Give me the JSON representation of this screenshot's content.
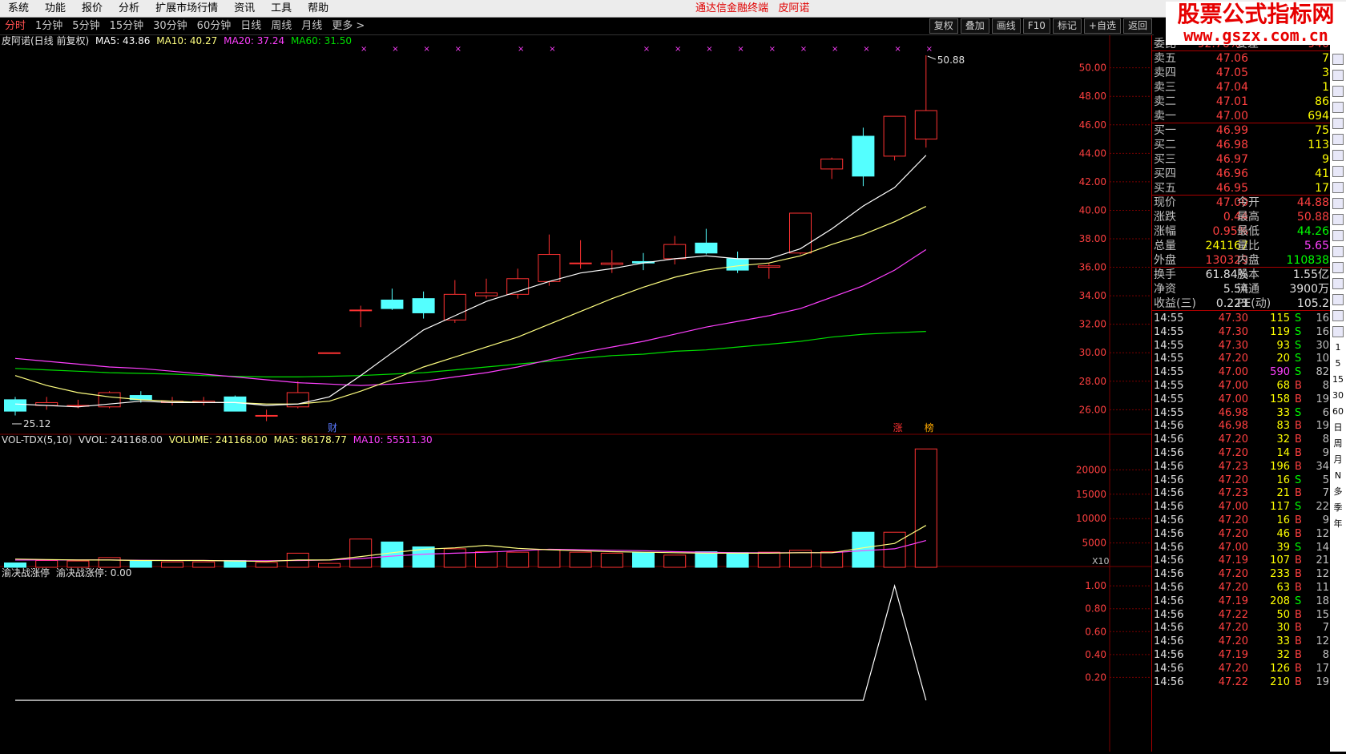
{
  "menu": [
    "系统",
    "功能",
    "报价",
    "分析",
    "扩展市场行情",
    "资讯",
    "工具",
    "帮助"
  ],
  "window_title": "通达信金融终端",
  "stock_name": "皮阿诺",
  "periods": [
    "分时",
    "1分钟",
    "5分钟",
    "15分钟",
    "30分钟",
    "60分钟",
    "日线",
    "周线",
    "月线",
    "更多 >"
  ],
  "active_period": "分时",
  "toolbar_buttons": [
    "复权",
    "叠加",
    "画线",
    "F10",
    "标记",
    "+自选",
    "返回"
  ],
  "logo": {
    "line1": "股票公式指标网",
    "line2": "www.gszx.com.cn"
  },
  "main_header": {
    "name": "皮阿诺(日线 前复权)",
    "ma5": "MA5: 43.86",
    "ma10": "MA10: 40.27",
    "ma20": "MA20: 37.24",
    "ma60": "MA60: 31.50"
  },
  "vol_header": {
    "name": "VOL-TDX(5,10)",
    "vvol": "VVOL: 241168.00",
    "volume": "VOLUME: 241168.00",
    "ma5": "MA5: 86178.77",
    "ma10": "MA10: 55511.30"
  },
  "ind_header": {
    "name": "渝决战涨停",
    "val": "渝决战涨停: 0.00"
  },
  "x10": "X10",
  "price_labels": [
    "50.00",
    "48.00",
    "46.00",
    "44.00",
    "42.00",
    "40.00",
    "38.00",
    "36.00",
    "34.00",
    "32.00",
    "30.00",
    "28.00",
    "26.00"
  ],
  "vol_labels": [
    "20000",
    "15000",
    "10000",
    "5000"
  ],
  "ind_labels": [
    "1.00",
    "0.80",
    "0.60",
    "0.40",
    "0.20"
  ],
  "high_mark": "50.88",
  "low_mark": "25.12",
  "events": [
    "财",
    "涨",
    "榜"
  ],
  "colors": {
    "up": "#ff3232",
    "down": "#54ffff",
    "ma5": "#ffffff",
    "ma10": "#ffff80",
    "ma20": "#ff40ff",
    "ma60": "#00e000",
    "grid": "#7a0000"
  },
  "chart_data": {
    "type": "candlestick",
    "ylim": [
      24.5,
      51.5
    ],
    "candles": [
      {
        "o": 26.7,
        "c": 25.9,
        "h": 26.9,
        "l": 25.6
      },
      {
        "o": 26.3,
        "c": 26.5,
        "h": 26.9,
        "l": 26.0
      },
      {
        "o": 26.3,
        "c": 26.3,
        "h": 26.7,
        "l": 26.1
      },
      {
        "o": 26.2,
        "c": 27.2,
        "h": 27.3,
        "l": 26.1
      },
      {
        "o": 27.0,
        "c": 26.7,
        "h": 27.3,
        "l": 26.5
      },
      {
        "o": 26.5,
        "c": 26.6,
        "h": 26.9,
        "l": 26.3
      },
      {
        "o": 26.5,
        "c": 26.6,
        "h": 26.9,
        "l": 26.3
      },
      {
        "o": 26.9,
        "c": 25.9,
        "h": 27.0,
        "l": 25.9
      },
      {
        "o": 25.6,
        "c": 25.6,
        "h": 26.0,
        "l": 25.2
      },
      {
        "o": 26.2,
        "c": 27.2,
        "h": 28.0,
        "l": 26.1
      },
      {
        "o": 30.0,
        "c": 30.0,
        "h": 30.0,
        "l": 30.0
      },
      {
        "o": 33.0,
        "c": 33.0,
        "h": 33.3,
        "l": 31.8
      },
      {
        "o": 33.7,
        "c": 33.1,
        "h": 34.5,
        "l": 33.0
      },
      {
        "o": 33.8,
        "c": 32.8,
        "h": 34.3,
        "l": 32.4
      },
      {
        "o": 32.3,
        "c": 34.1,
        "h": 35.1,
        "l": 32.1
      },
      {
        "o": 34.0,
        "c": 34.2,
        "h": 35.2,
        "l": 33.8
      },
      {
        "o": 34.1,
        "c": 35.2,
        "h": 35.9,
        "l": 33.8
      },
      {
        "o": 35.0,
        "c": 36.9,
        "h": 38.3,
        "l": 34.7
      },
      {
        "o": 36.3,
        "c": 36.3,
        "h": 37.9,
        "l": 35.9
      },
      {
        "o": 36.2,
        "c": 36.3,
        "h": 37.2,
        "l": 35.6
      },
      {
        "o": 36.4,
        "c": 36.3,
        "h": 37.0,
        "l": 35.8
      },
      {
        "o": 36.6,
        "c": 37.6,
        "h": 38.2,
        "l": 36.2
      },
      {
        "o": 37.7,
        "c": 37.0,
        "h": 38.7,
        "l": 36.9
      },
      {
        "o": 36.6,
        "c": 35.8,
        "h": 37.1,
        "l": 35.6
      },
      {
        "o": 36.0,
        "c": 36.1,
        "h": 36.3,
        "l": 35.2
      },
      {
        "o": 37.0,
        "c": 39.8,
        "h": 39.8,
        "l": 36.9
      },
      {
        "o": 42.9,
        "c": 43.6,
        "h": 43.7,
        "l": 42.2
      },
      {
        "o": 45.2,
        "c": 42.4,
        "h": 45.8,
        "l": 41.7
      },
      {
        "o": 43.8,
        "c": 46.6,
        "h": 46.6,
        "l": 43.5
      },
      {
        "o": 45.0,
        "c": 47.0,
        "h": 50.88,
        "l": 44.4
      }
    ],
    "ma5": [
      26.4,
      26.3,
      26.2,
      26.4,
      26.6,
      26.5,
      26.5,
      26.5,
      26.3,
      26.4,
      26.9,
      28.4,
      30.0,
      31.6,
      32.6,
      33.6,
      34.3,
      35.0,
      35.6,
      35.9,
      36.3,
      36.6,
      36.8,
      36.6,
      36.6,
      37.3,
      38.7,
      40.3,
      41.6,
      43.86
    ],
    "ma10": [
      28.4,
      27.7,
      27.2,
      26.9,
      26.7,
      26.6,
      26.5,
      26.5,
      26.4,
      26.4,
      26.6,
      27.3,
      28.1,
      29.0,
      29.7,
      30.4,
      31.1,
      32.0,
      32.9,
      33.8,
      34.6,
      35.3,
      35.8,
      36.1,
      36.3,
      36.8,
      37.6,
      38.3,
      39.2,
      40.27
    ],
    "ma20": [
      29.6,
      29.4,
      29.2,
      29.0,
      28.9,
      28.7,
      28.5,
      28.3,
      28.1,
      27.9,
      27.8,
      27.7,
      27.8,
      28.0,
      28.3,
      28.6,
      29.0,
      29.5,
      30.0,
      30.4,
      30.8,
      31.3,
      31.8,
      32.2,
      32.6,
      33.1,
      33.9,
      34.7,
      35.8,
      37.24
    ],
    "ma60": [
      28.9,
      28.8,
      28.7,
      28.6,
      28.55,
      28.5,
      28.4,
      28.35,
      28.3,
      28.3,
      28.35,
      28.4,
      28.5,
      28.6,
      28.8,
      29.0,
      29.2,
      29.4,
      29.6,
      29.8,
      29.9,
      30.1,
      30.2,
      30.4,
      30.6,
      30.8,
      31.1,
      31.3,
      31.4,
      31.5
    ],
    "volume": [
      900,
      1400,
      1300,
      2000,
      1300,
      1100,
      1100,
      1400,
      1000,
      2900,
      800,
      5800,
      5200,
      4200,
      3800,
      3200,
      3100,
      3700,
      3100,
      2900,
      3000,
      2500,
      3200,
      3000,
      3100,
      3500,
      3200,
      7200,
      7200,
      24300
    ],
    "vol_ma5": [
      1700,
      1600,
      1500,
      1500,
      1400,
      1400,
      1400,
      1300,
      1200,
      1500,
      1500,
      2200,
      3000,
      3700,
      4000,
      4500,
      3900,
      3600,
      3400,
      3200,
      3100,
      3000,
      2900,
      2900,
      2900,
      3000,
      3000,
      4000,
      4900,
      8600
    ],
    "vol_ma10": [
      1500,
      1500,
      1500,
      1500,
      1450,
      1400,
      1400,
      1350,
      1350,
      1400,
      1500,
      1800,
      2300,
      2700,
      2900,
      3100,
      3400,
      3700,
      3600,
      3500,
      3400,
      3200,
      3100,
      3000,
      3000,
      3000,
      3000,
      3400,
      3800,
      5500
    ],
    "vol_ylim": [
      0,
      25000
    ],
    "indicator": [
      0,
      0,
      0,
      0,
      0,
      0,
      0,
      0,
      0,
      0,
      0,
      0,
      0,
      0,
      0,
      0,
      0,
      0,
      0,
      0,
      0,
      0,
      0,
      0,
      0,
      0,
      0,
      0,
      1,
      0
    ],
    "ind_ylim": [
      0,
      1.05
    ]
  },
  "quote": {
    "weibi": {
      "label": "委比",
      "val": "92.76%",
      "extra": "委差",
      "extra_val": "940"
    },
    "asks": [
      {
        "label": "卖五",
        "price": "47.06",
        "vol": "7"
      },
      {
        "label": "卖四",
        "price": "47.05",
        "vol": "3"
      },
      {
        "label": "卖三",
        "price": "47.04",
        "vol": "1"
      },
      {
        "label": "卖二",
        "price": "47.01",
        "vol": "86"
      },
      {
        "label": "卖一",
        "price": "47.00",
        "vol": "694"
      }
    ],
    "bids": [
      {
        "label": "买一",
        "price": "46.99",
        "vol": "75"
      },
      {
        "label": "买二",
        "price": "46.98",
        "vol": "113"
      },
      {
        "label": "买三",
        "price": "46.97",
        "vol": "9"
      },
      {
        "label": "买四",
        "price": "46.96",
        "vol": "41"
      },
      {
        "label": "买五",
        "price": "46.95",
        "vol": "17"
      }
    ],
    "stats": [
      {
        "l1": "现价",
        "v1": "47.00",
        "c1": "#ff4040",
        "l2": "今开",
        "v2": "44.88",
        "c2": "#ff4040"
      },
      {
        "l1": "涨跌",
        "v1": "0.44",
        "c1": "#ff4040",
        "l2": "最高",
        "v2": "50.88",
        "c2": "#ff4040"
      },
      {
        "l1": "涨幅",
        "v1": "0.95%",
        "c1": "#ff4040",
        "l2": "最低",
        "v2": "44.26",
        "c2": "#00ff00"
      },
      {
        "l1": "总量",
        "v1": "241167",
        "c1": "#ffff00",
        "l2": "量比",
        "v2": "5.65",
        "c2": "#ff40ff"
      },
      {
        "l1": "外盘",
        "v1": "130329",
        "c1": "#ff4040",
        "l2": "内盘",
        "v2": "110838",
        "c2": "#00ff00"
      }
    ],
    "stats2": [
      {
        "l1": "换手",
        "v1": "61.84%",
        "l2": "股本",
        "v2": "1.55亿"
      },
      {
        "l1": "净资",
        "v1": "5.54",
        "l2": "流通",
        "v2": "3900万"
      },
      {
        "l1": "收益(三)",
        "v1": "0.223",
        "l2": "PE(动)",
        "v2": "105.2"
      }
    ],
    "ticks": [
      [
        "14:55",
        "47.30",
        "115",
        "S",
        "16"
      ],
      [
        "14:55",
        "47.30",
        "119",
        "S",
        "16"
      ],
      [
        "14:55",
        "47.30",
        "93",
        "S",
        "30"
      ],
      [
        "14:55",
        "47.20",
        "20",
        "S",
        "10"
      ],
      [
        "14:55",
        "47.00",
        "590",
        "S",
        "82"
      ],
      [
        "14:55",
        "47.00",
        "68",
        "B",
        "8"
      ],
      [
        "14:55",
        "47.00",
        "158",
        "B",
        "19"
      ],
      [
        "14:55",
        "46.98",
        "33",
        "S",
        "6"
      ],
      [
        "14:56",
        "46.98",
        "83",
        "B",
        "19"
      ],
      [
        "14:56",
        "47.20",
        "32",
        "B",
        "8"
      ],
      [
        "14:56",
        "47.20",
        "14",
        "B",
        "9"
      ],
      [
        "14:56",
        "47.23",
        "196",
        "B",
        "34"
      ],
      [
        "14:56",
        "47.20",
        "16",
        "S",
        "5"
      ],
      [
        "14:56",
        "47.23",
        "21",
        "B",
        "7"
      ],
      [
        "14:56",
        "47.00",
        "117",
        "S",
        "22"
      ],
      [
        "14:56",
        "47.20",
        "16",
        "B",
        "9"
      ],
      [
        "14:56",
        "47.20",
        "46",
        "B",
        "12"
      ],
      [
        "14:56",
        "47.00",
        "39",
        "S",
        "14"
      ],
      [
        "14:56",
        "47.19",
        "107",
        "B",
        "21"
      ],
      [
        "14:56",
        "47.20",
        "233",
        "B",
        "12"
      ],
      [
        "14:56",
        "47.20",
        "63",
        "B",
        "11"
      ],
      [
        "14:56",
        "47.19",
        "208",
        "S",
        "18"
      ],
      [
        "14:56",
        "47.22",
        "50",
        "B",
        "15"
      ],
      [
        "14:56",
        "47.20",
        "30",
        "B",
        "7"
      ],
      [
        "14:56",
        "47.20",
        "33",
        "B",
        "12"
      ],
      [
        "14:56",
        "47.19",
        "32",
        "B",
        "8"
      ],
      [
        "14:56",
        "47.20",
        "126",
        "B",
        "17"
      ],
      [
        "14:56",
        "47.22",
        "210",
        "B",
        "19"
      ]
    ]
  },
  "side_strip": [
    "1",
    "5",
    "15",
    "30",
    "60",
    "日",
    "周",
    "月",
    "N",
    "多",
    "季",
    "年"
  ]
}
